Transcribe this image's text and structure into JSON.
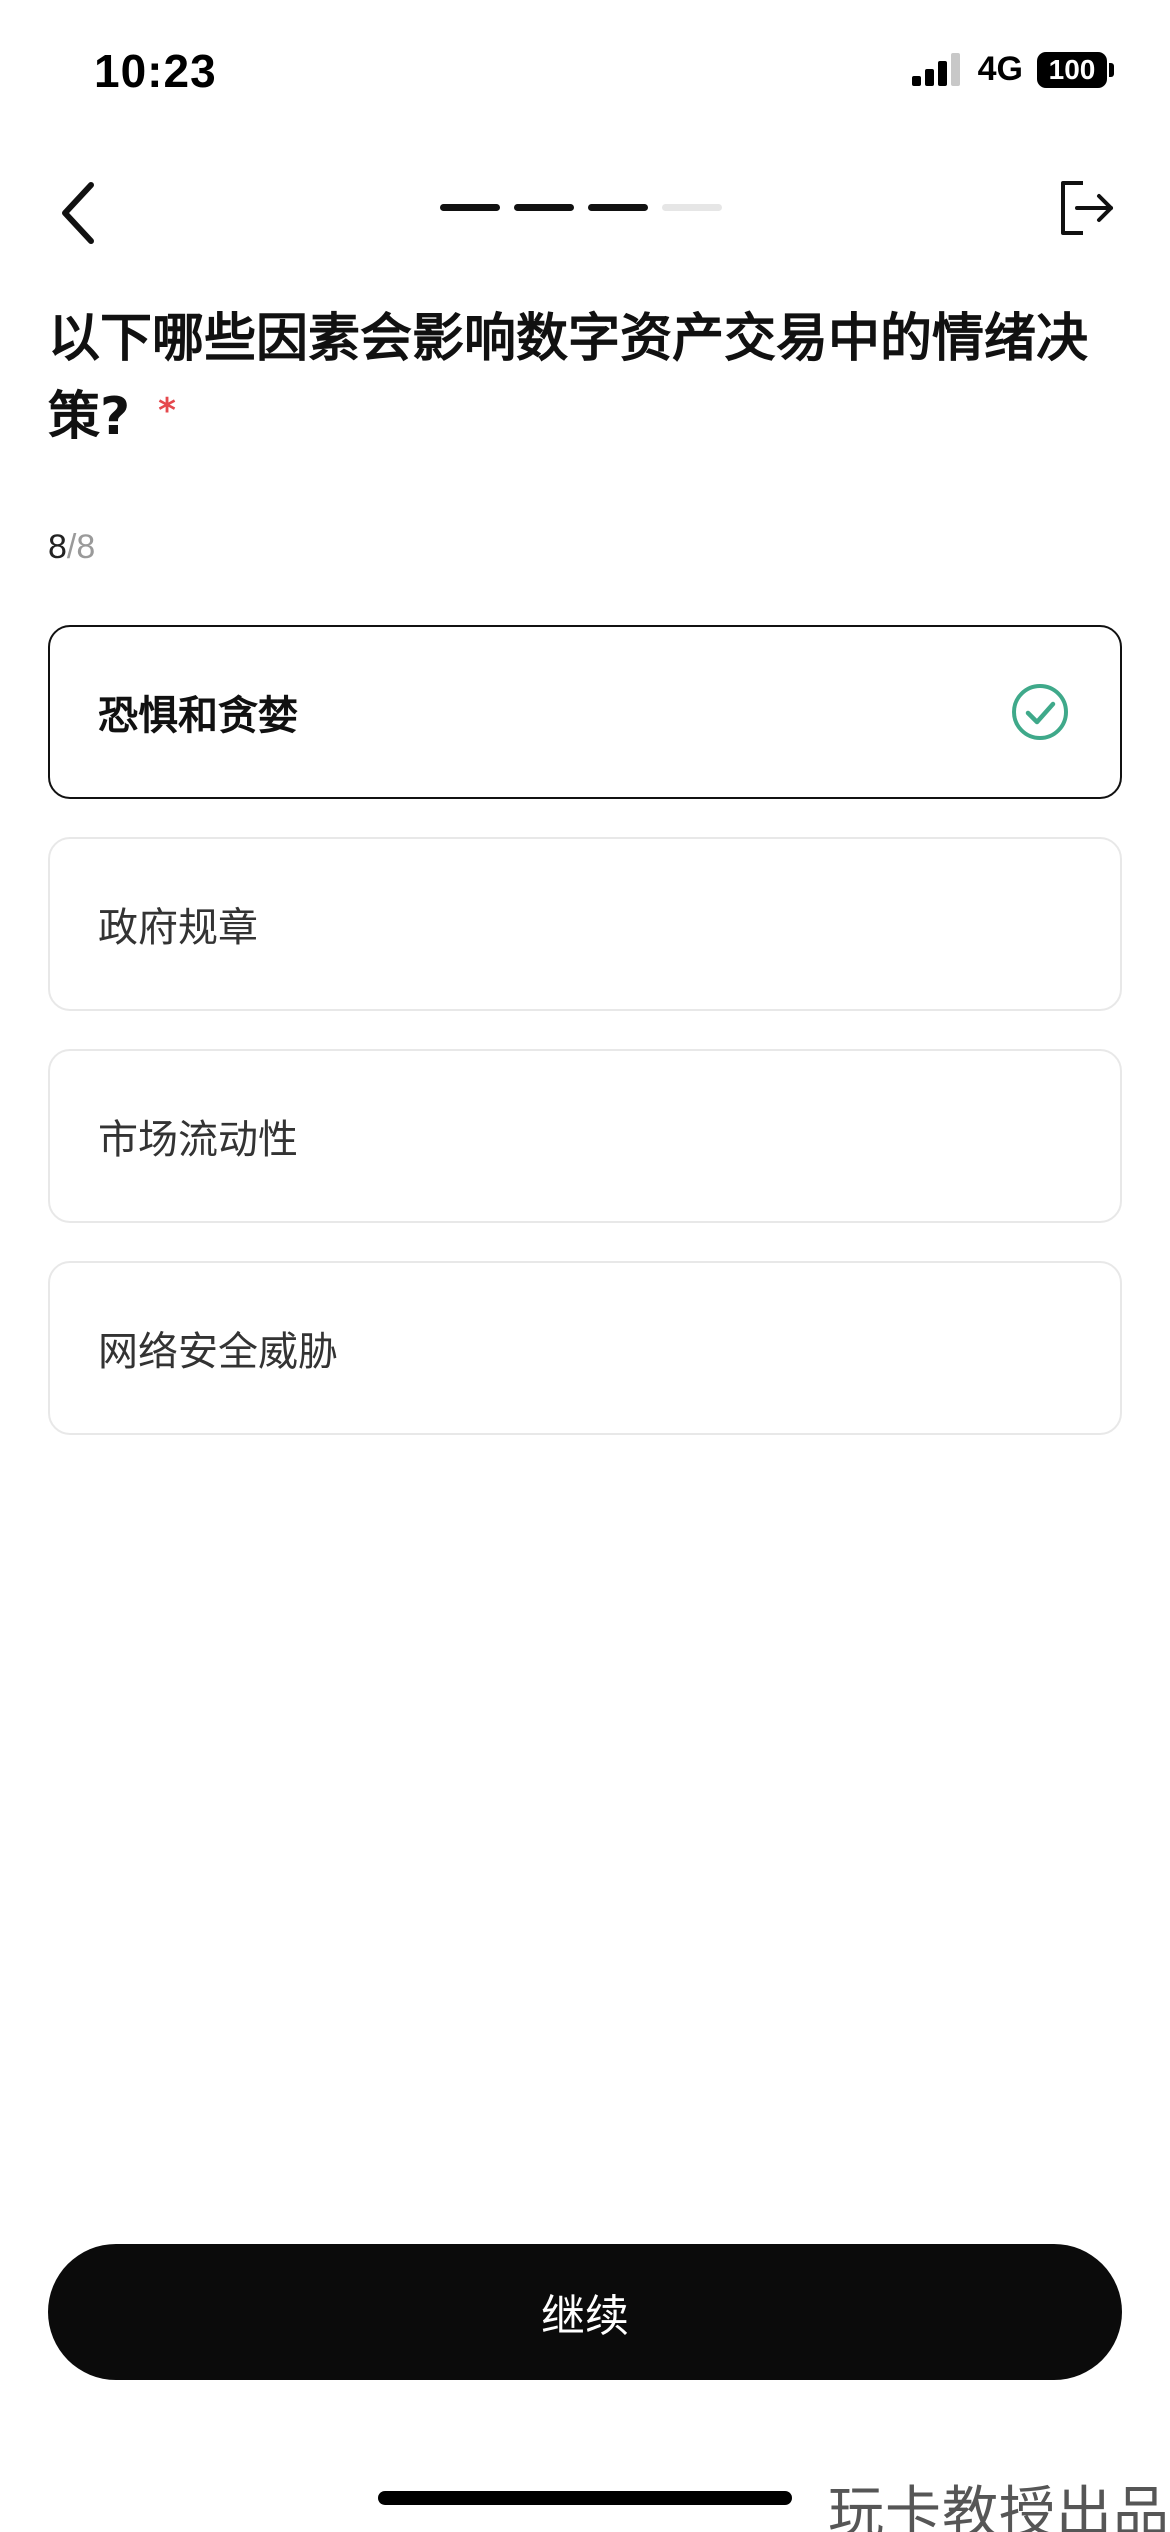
{
  "status_bar": {
    "time": "10:23",
    "network": "4G",
    "battery": "100"
  },
  "header": {
    "progress_total": 4,
    "progress_completed": 3
  },
  "question": {
    "text": "以下哪些因素会影响数字资产交易中的情绪决策?",
    "required_mark": "*"
  },
  "counter": {
    "current": "8",
    "separator": "/",
    "total": "8"
  },
  "options": [
    {
      "label": "恐惧和贪婪",
      "selected": true
    },
    {
      "label": "政府规章",
      "selected": false
    },
    {
      "label": "市场流动性",
      "selected": false
    },
    {
      "label": "网络安全威胁",
      "selected": false
    }
  ],
  "continue_label": "继续",
  "watermark": "玩卡教授出品",
  "colors": {
    "accent_check": "#3fa98a",
    "button_bg": "#0b0b0b",
    "required": "#e5484d"
  }
}
